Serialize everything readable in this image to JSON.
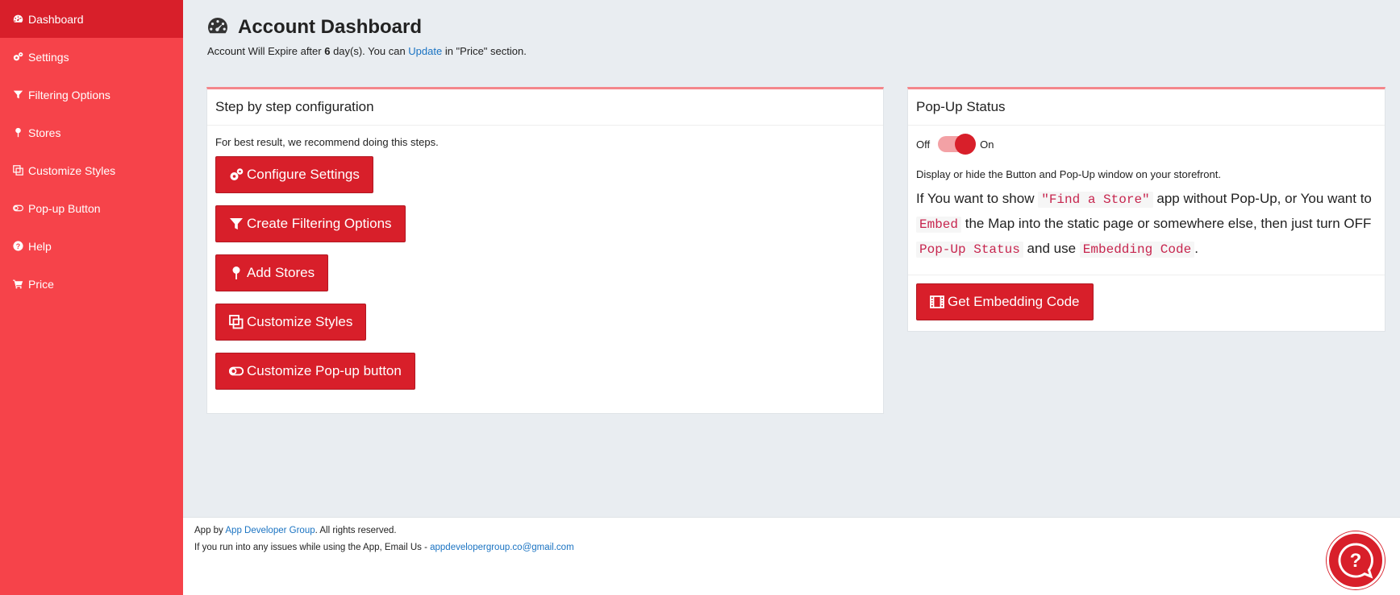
{
  "sidebar": {
    "items": [
      {
        "label": "Dashboard",
        "icon": "dashboard-icon"
      },
      {
        "label": "Settings",
        "icon": "gears-icon"
      },
      {
        "label": "Filtering Options",
        "icon": "filter-icon"
      },
      {
        "label": "Stores",
        "icon": "pin-icon"
      },
      {
        "label": "Customize Styles",
        "icon": "copy-icon"
      },
      {
        "label": "Pop-up Button",
        "icon": "toggle-icon"
      },
      {
        "label": "Help",
        "icon": "question-circle-icon"
      },
      {
        "label": "Price",
        "icon": "cart-icon"
      }
    ]
  },
  "header": {
    "title": "Account Dashboard",
    "expire_prefix": "Account Will Expire after ",
    "expire_days": "6",
    "expire_mid": " day(s). You can ",
    "update_link": "Update",
    "expire_suffix": " in \"Price\" section."
  },
  "steps_card": {
    "title": "Step by step configuration",
    "intro": "For best result, we recommend doing this steps.",
    "buttons": [
      "Configure Settings",
      "Create Filtering Options",
      "Add Stores",
      "Customize Styles",
      "Customize Pop-up button"
    ]
  },
  "popup_card": {
    "title": "Pop-Up Status",
    "off_label": "Off",
    "on_label": "On",
    "toggle_on": true,
    "description": "Display or hide the Button and Pop-Up window on your storefront.",
    "text_1": "If You want to show ",
    "code_1": "\"Find a Store\"",
    "text_2": " app without Pop-Up, or You want to ",
    "code_2": "Embed",
    "text_3": " the Map into the static page or somewhere else, then just turn OFF ",
    "code_3": "Pop-Up Status",
    "text_4": " and use ",
    "code_4": "Embedding Code",
    "text_5": ".",
    "embed_button": "Get Embedding Code"
  },
  "footer": {
    "line1_prefix": "App by ",
    "company_link": "App Developer Group",
    "line1_suffix": ". All rights reserved.",
    "line2_prefix": "If you run into any issues while using the App, Email Us - ",
    "email_link": "appdevelopergroup.co@gmail.com"
  },
  "colors": {
    "sidebar": "#f6434a",
    "sidebar_active": "#d81f2a",
    "primary_button": "#d81f2a",
    "link": "#1a73c2"
  }
}
